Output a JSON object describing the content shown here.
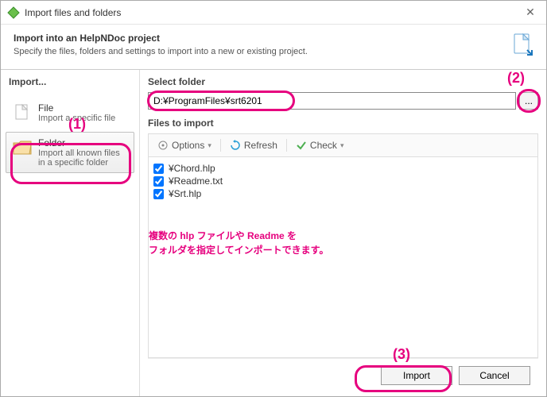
{
  "window": {
    "title": "Import files and folders"
  },
  "header": {
    "title": "Import into an HelpNDoc project",
    "subtitle": "Specify the files, folders and settings to import into a new or existing project."
  },
  "left": {
    "title": "Import...",
    "file": {
      "title": "File",
      "desc": "Import a specific file"
    },
    "folder": {
      "title": "Folder",
      "desc": "Import all known files in a specific folder"
    }
  },
  "right": {
    "select_folder_label": "Select folder",
    "path_value": "D:¥ProgramFiles¥srt6201",
    "browse_label": "...",
    "files_label": "Files to import",
    "toolbar": {
      "options": "Options",
      "refresh": "Refresh",
      "check": "Check"
    },
    "files": [
      "¥Chord.hlp",
      "¥Readme.txt",
      "¥Srt.hlp"
    ]
  },
  "footer": {
    "import": "Import",
    "cancel": "Cancel"
  },
  "annotations": {
    "a1": "(1)",
    "a2": "(2)",
    "a3": "(3)",
    "line1": "複数の hlp ファイルや Readme を",
    "line2": "フォルダを指定してインポートできます。"
  }
}
